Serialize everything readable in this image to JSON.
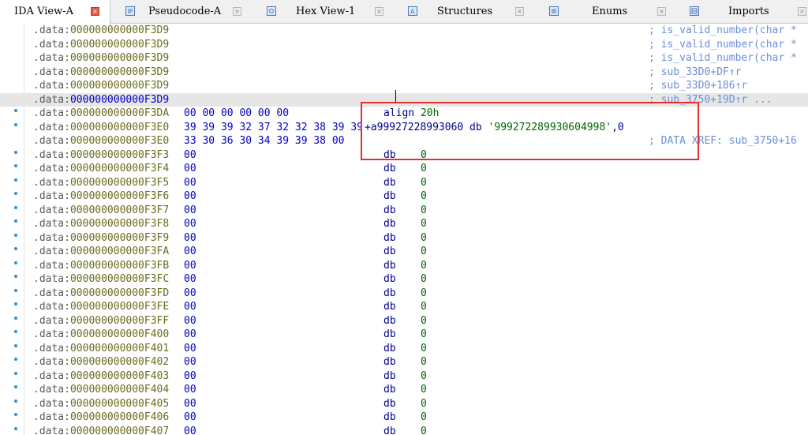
{
  "tabs": [
    {
      "label": "IDA View-A",
      "icon": "none",
      "active": true
    },
    {
      "label": "Pseudocode-A",
      "icon": "pseudocode-icon",
      "active": false
    },
    {
      "label": "Hex View-1",
      "icon": "hex-view-icon",
      "active": false
    },
    {
      "label": "Structures",
      "icon": "structures-icon",
      "active": false
    },
    {
      "label": "Enums",
      "icon": "enums-icon",
      "active": false
    },
    {
      "label": "Imports",
      "icon": "imports-icon",
      "active": false
    }
  ],
  "tab_close_glyph": "×",
  "listing": {
    "rows": [
      {
        "seg": ".data:",
        "addr": "000000000000F3D9",
        "bytes": "",
        "instr": "",
        "comment": "; is_valid_number(char *",
        "dot": false,
        "highlight": false
      },
      {
        "seg": ".data:",
        "addr": "000000000000F3D9",
        "bytes": "",
        "instr": "",
        "comment": "; is_valid_number(char *",
        "dot": false,
        "highlight": false
      },
      {
        "seg": ".data:",
        "addr": "000000000000F3D9",
        "bytes": "",
        "instr": "",
        "comment": "; is_valid_number(char *",
        "dot": false,
        "highlight": false
      },
      {
        "seg": ".data:",
        "addr": "000000000000F3D9",
        "bytes": "",
        "instr": "",
        "comment": "; sub_33D0+DF↑r",
        "dot": false,
        "highlight": false
      },
      {
        "seg": ".data:",
        "addr": "000000000000F3D9",
        "bytes": "",
        "instr": "",
        "comment": "; sub_33D0+186↑r",
        "dot": false,
        "highlight": false
      },
      {
        "seg": ".data:",
        "addr": "000000000000F3D9",
        "bytes": "",
        "instr": "",
        "comment": "; sub_3750+19D↑r ...",
        "dot": false,
        "highlight": true
      },
      {
        "seg": ".data:",
        "addr": "000000000000F3DA",
        "bytes": "00 00 00 00 00 00",
        "instr": "align 20h",
        "comment": "",
        "dot": true,
        "highlight": false
      },
      {
        "seg": ".data:",
        "addr": "000000000000F3E0",
        "bytes": "39 39 39 32 37 32 32 38 39 39",
        "instr": "+a99927228993060 db '999272289930604998',0",
        "comment": "",
        "dot": true,
        "highlight": false
      },
      {
        "seg": ".data:",
        "addr": "000000000000F3E0",
        "bytes": "33 30 36 30 34 39 39 38 00",
        "instr": "",
        "comment": "; DATA XREF: sub_3750+16",
        "dot": false,
        "highlight": false
      },
      {
        "seg": ".data:",
        "addr": "000000000000F3F3",
        "bytes": "00",
        "instr": "db    0",
        "comment": "",
        "dot": true,
        "highlight": false
      },
      {
        "seg": ".data:",
        "addr": "000000000000F3F4",
        "bytes": "00",
        "instr": "db    0",
        "comment": "",
        "dot": true,
        "highlight": false
      },
      {
        "seg": ".data:",
        "addr": "000000000000F3F5",
        "bytes": "00",
        "instr": "db    0",
        "comment": "",
        "dot": true,
        "highlight": false
      },
      {
        "seg": ".data:",
        "addr": "000000000000F3F6",
        "bytes": "00",
        "instr": "db    0",
        "comment": "",
        "dot": true,
        "highlight": false
      },
      {
        "seg": ".data:",
        "addr": "000000000000F3F7",
        "bytes": "00",
        "instr": "db    0",
        "comment": "",
        "dot": true,
        "highlight": false
      },
      {
        "seg": ".data:",
        "addr": "000000000000F3F8",
        "bytes": "00",
        "instr": "db    0",
        "comment": "",
        "dot": true,
        "highlight": false
      },
      {
        "seg": ".data:",
        "addr": "000000000000F3F9",
        "bytes": "00",
        "instr": "db    0",
        "comment": "",
        "dot": true,
        "highlight": false
      },
      {
        "seg": ".data:",
        "addr": "000000000000F3FA",
        "bytes": "00",
        "instr": "db    0",
        "comment": "",
        "dot": true,
        "highlight": false
      },
      {
        "seg": ".data:",
        "addr": "000000000000F3FB",
        "bytes": "00",
        "instr": "db    0",
        "comment": "",
        "dot": true,
        "highlight": false
      },
      {
        "seg": ".data:",
        "addr": "000000000000F3FC",
        "bytes": "00",
        "instr": "db    0",
        "comment": "",
        "dot": true,
        "highlight": false
      },
      {
        "seg": ".data:",
        "addr": "000000000000F3FD",
        "bytes": "00",
        "instr": "db    0",
        "comment": "",
        "dot": true,
        "highlight": false
      },
      {
        "seg": ".data:",
        "addr": "000000000000F3FE",
        "bytes": "00",
        "instr": "db    0",
        "comment": "",
        "dot": true,
        "highlight": false
      },
      {
        "seg": ".data:",
        "addr": "000000000000F3FF",
        "bytes": "00",
        "instr": "db    0",
        "comment": "",
        "dot": true,
        "highlight": false
      },
      {
        "seg": ".data:",
        "addr": "000000000000F400",
        "bytes": "00",
        "instr": "db    0",
        "comment": "",
        "dot": true,
        "highlight": false
      },
      {
        "seg": ".data:",
        "addr": "000000000000F401",
        "bytes": "00",
        "instr": "db    0",
        "comment": "",
        "dot": true,
        "highlight": false
      },
      {
        "seg": ".data:",
        "addr": "000000000000F402",
        "bytes": "00",
        "instr": "db    0",
        "comment": "",
        "dot": true,
        "highlight": false
      },
      {
        "seg": ".data:",
        "addr": "000000000000F403",
        "bytes": "00",
        "instr": "db    0",
        "comment": "",
        "dot": true,
        "highlight": false
      },
      {
        "seg": ".data:",
        "addr": "000000000000F404",
        "bytes": "00",
        "instr": "db    0",
        "comment": "",
        "dot": true,
        "highlight": false
      },
      {
        "seg": ".data:",
        "addr": "000000000000F405",
        "bytes": "00",
        "instr": "db    0",
        "comment": "",
        "dot": true,
        "highlight": false
      },
      {
        "seg": ".data:",
        "addr": "000000000000F406",
        "bytes": "00",
        "instr": "db    0",
        "comment": "",
        "dot": true,
        "highlight": false
      },
      {
        "seg": ".data:",
        "addr": "000000000000F407",
        "bytes": "00",
        "instr": "db    0",
        "comment": "",
        "dot": true,
        "highlight": false
      }
    ]
  },
  "colors": {
    "active_close": "#e25b4b",
    "highlight_row": "#e6e6e6",
    "annotation_box": "#e03030",
    "comment": "#6b8fd8",
    "bytes": "#0000c0"
  }
}
